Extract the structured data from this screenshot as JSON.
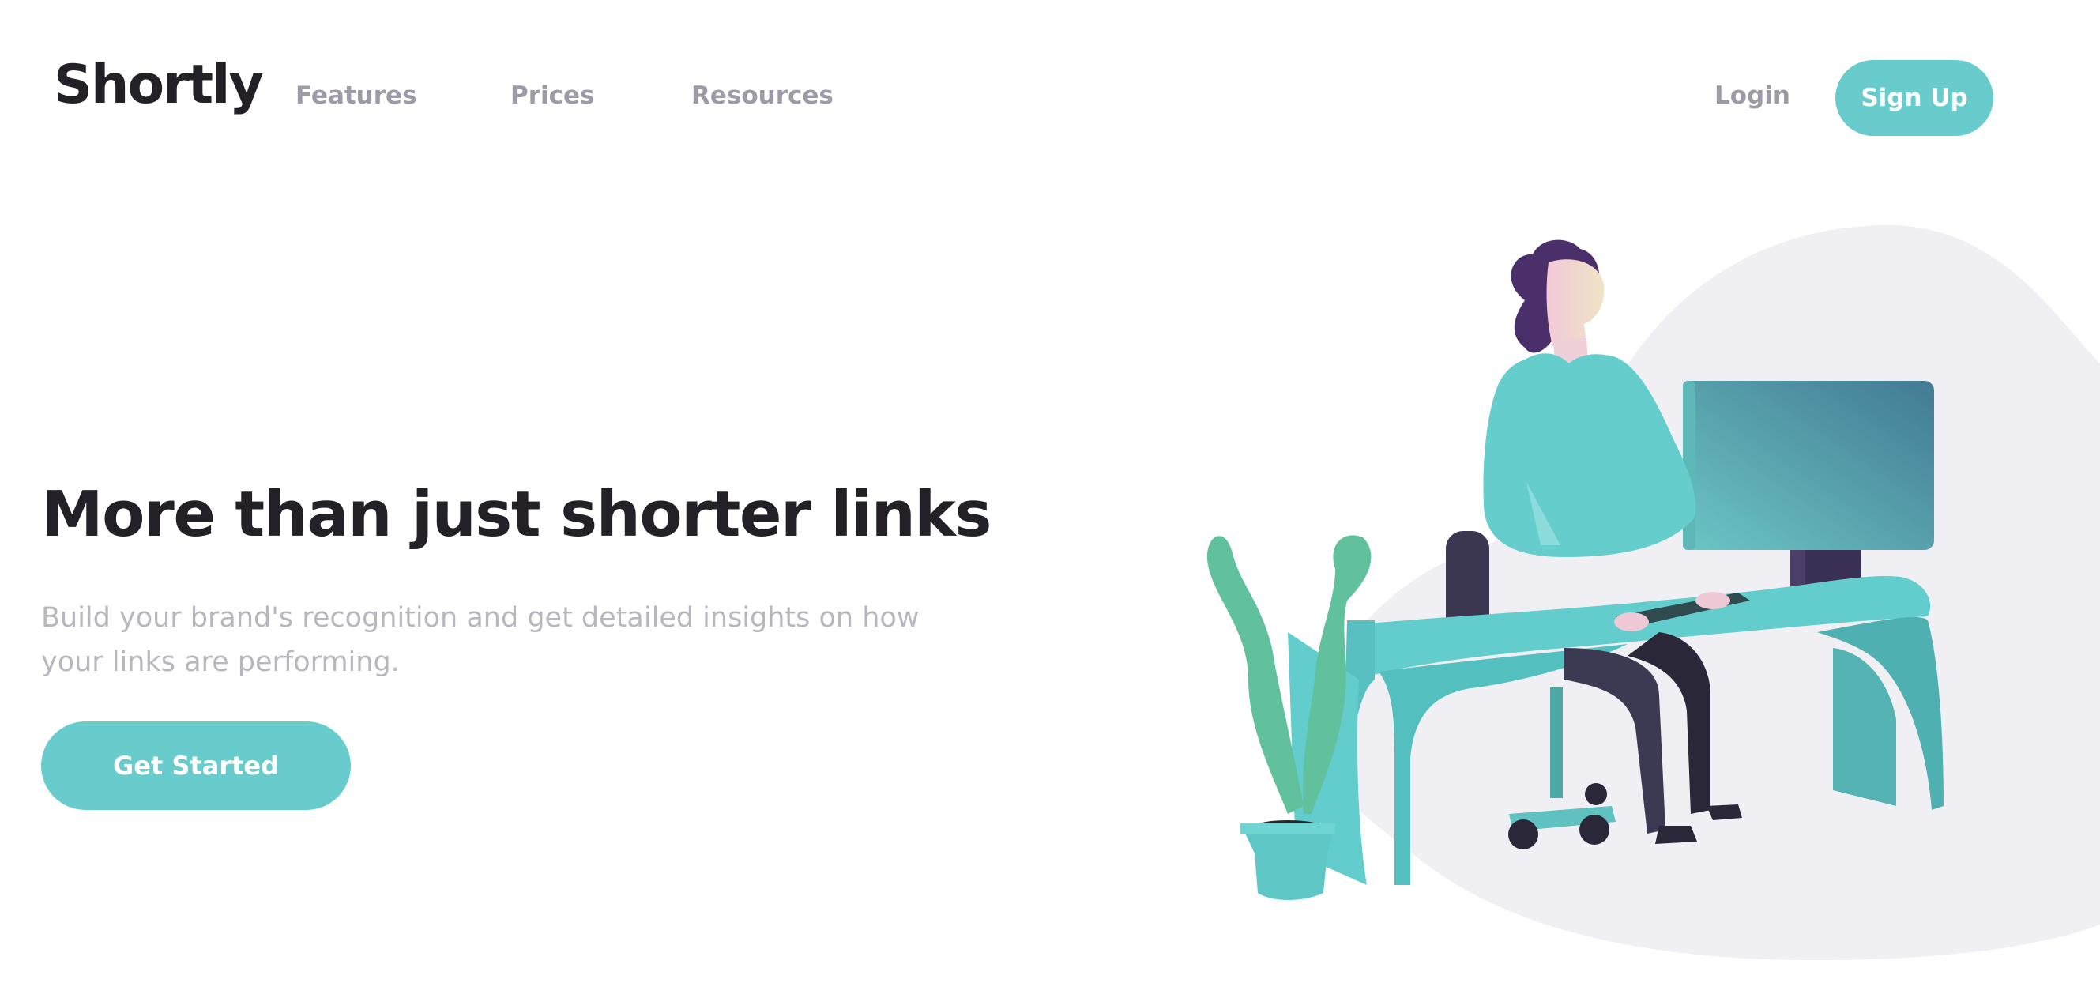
{
  "header": {
    "logo": "Shortly",
    "nav": {
      "features": "Features",
      "prices": "Prices",
      "resources": "Resources"
    },
    "login": "Login",
    "signup": "Sign Up"
  },
  "hero": {
    "title": "More than just shorter links",
    "subtitle": "Build your brand's recognition and get detailed insights on how your links are performing.",
    "cta": "Get Started",
    "illustration_icon": "person-working-illustration"
  },
  "colors": {
    "accent": "#67cccb",
    "dark_text": "#232127",
    "muted_text": "#9e9aa8",
    "blob": "#efeff4"
  }
}
